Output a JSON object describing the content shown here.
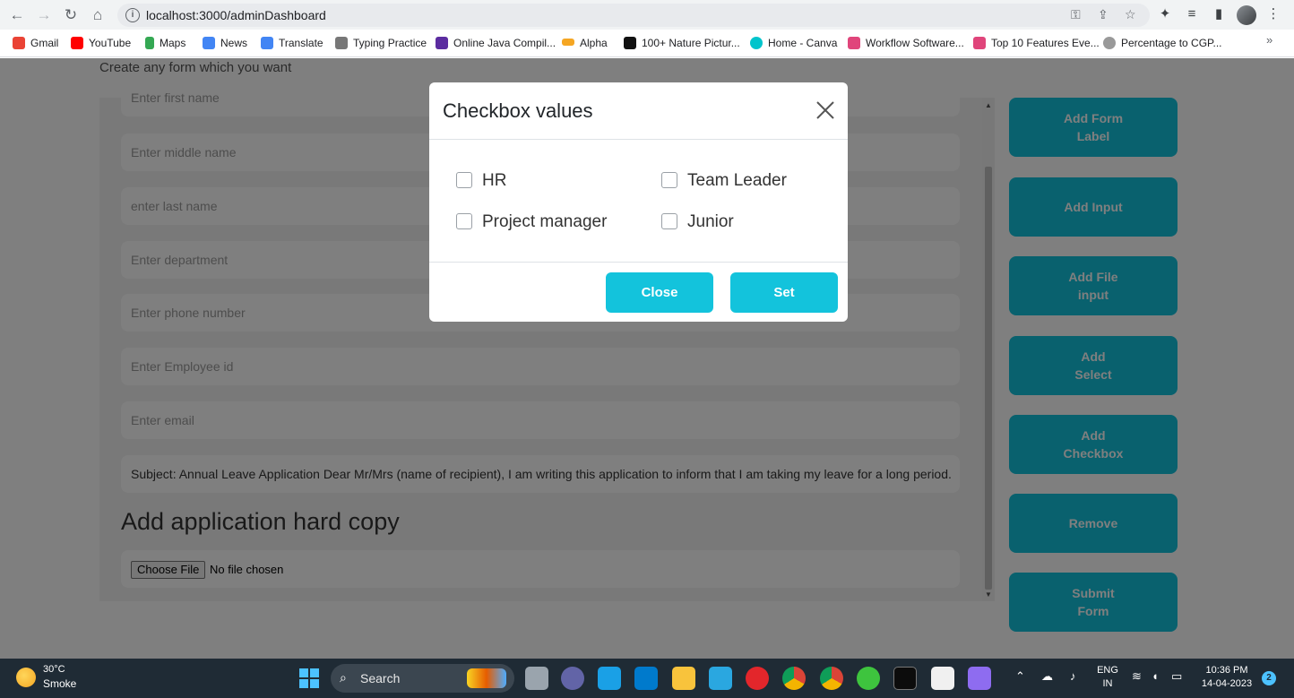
{
  "browser": {
    "url": "localhost:3000/adminDashboard",
    "bookmarks": [
      {
        "label": "Gmail",
        "color": "#ea4335"
      },
      {
        "label": "YouTube",
        "color": "#ff0000"
      },
      {
        "label": "Maps",
        "color": "#34a853"
      },
      {
        "label": "News",
        "color": "#4285f4"
      },
      {
        "label": "Translate",
        "color": "#4285f4"
      },
      {
        "label": "Typing Practice",
        "color": "#777777"
      },
      {
        "label": "Online Java Compil...",
        "color": "#5b2ca0"
      },
      {
        "label": "Alpha",
        "color": "#f5a623"
      },
      {
        "label": "100+ Nature Pictur...",
        "color": "#111111"
      },
      {
        "label": "Home - Canva",
        "color": "#00c4cc"
      },
      {
        "label": "Workflow Software...",
        "color": "#e0457b"
      },
      {
        "label": "Top 10 Features Eve...",
        "color": "#e0457b"
      },
      {
        "label": "Percentage to CGP...",
        "color": "#999999"
      }
    ],
    "more_label": "»"
  },
  "page": {
    "subtitle": "Create any form which you want",
    "fields": [
      "Enter first name",
      "Enter middle name",
      "enter last name",
      "Enter department",
      "Enter phone number",
      "Enter Employee id",
      "Enter email"
    ],
    "subject_text": "Subject: Annual Leave Application  Dear Mr/Mrs (name of recipient),  I am writing this application to inform that I am taking my leave for a long period.",
    "section_heading": "Add application hard copy",
    "choose_file_label": "Choose File",
    "no_file_label": "No file chosen",
    "side_buttons": [
      "Add Form Label",
      "Add Input",
      "Add File input",
      "Add Select",
      "Add Checkbox",
      "Remove",
      "Submit Form"
    ],
    "accent_color": "#13c3dc"
  },
  "modal": {
    "title": "Checkbox values",
    "options": [
      "HR",
      "Team Leader",
      "Project manager",
      "Junior"
    ],
    "close_label": "Close",
    "set_label": "Set"
  },
  "taskbar": {
    "weather_temp": "30°C",
    "weather_desc": "Smoke",
    "search_label": "Search",
    "lang_line1": "ENG",
    "lang_line2": "IN",
    "time": "10:36 PM",
    "date": "14-04-2023",
    "notification_count": "2"
  }
}
